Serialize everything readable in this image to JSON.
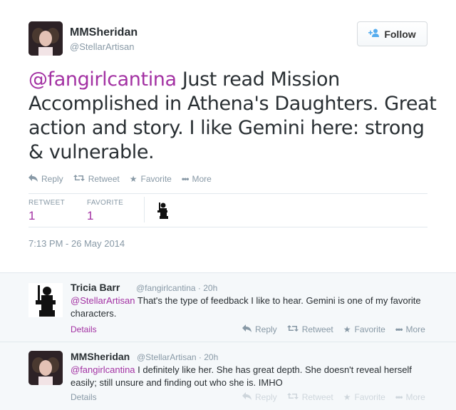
{
  "tweet": {
    "author_name": "MMSheridan",
    "author_handle": "@StellarArtisan",
    "follow_label": "Follow",
    "mention": "@fangirlcantina",
    "text": " Just read Mission Accomplished in Athena's Daughters. Great action and story. I like Gemini here: strong & vulnerable.",
    "actions": {
      "reply": "Reply",
      "retweet": "Retweet",
      "favorite": "Favorite",
      "more": "More"
    },
    "stats": {
      "retweet_label": "RETWEET",
      "retweet_count": "1",
      "favorite_label": "FAVORITE",
      "favorite_count": "1"
    },
    "timestamp": "7:13 PM - 26 May 2014"
  },
  "replies": [
    {
      "author_name": "Tricia Barr",
      "author_handle": "@fangirlcantina",
      "time": "· 20h",
      "mention": "@StellarArtisan",
      "text": " That's the type of feedback I like to hear. Gemini is one of my favorite characters.",
      "details": "Details",
      "actions": {
        "reply": "Reply",
        "retweet": "Retweet",
        "favorite": "Favorite",
        "more": "More"
      }
    },
    {
      "author_name": "MMSheridan",
      "author_handle": "@StellarArtisan",
      "time": "· 20h",
      "mention": "@fangirlcantina",
      "text": " I definitely like her. She has great depth. She doesn't reveal herself easily; still unsure and finding out who she is. IMHO",
      "details": "Details",
      "actions": {
        "reply": "Reply",
        "retweet": "Retweet",
        "favorite": "Favorite",
        "more": "More"
      }
    }
  ],
  "colors": {
    "mention": "#a332a3",
    "muted": "#8899a6",
    "follow_icon": "#55acee"
  },
  "icons": [
    "reply-icon",
    "retweet-icon",
    "favorite-star-icon",
    "more-dots-icon",
    "follow-person-plus-icon",
    "silhouette-icon"
  ]
}
